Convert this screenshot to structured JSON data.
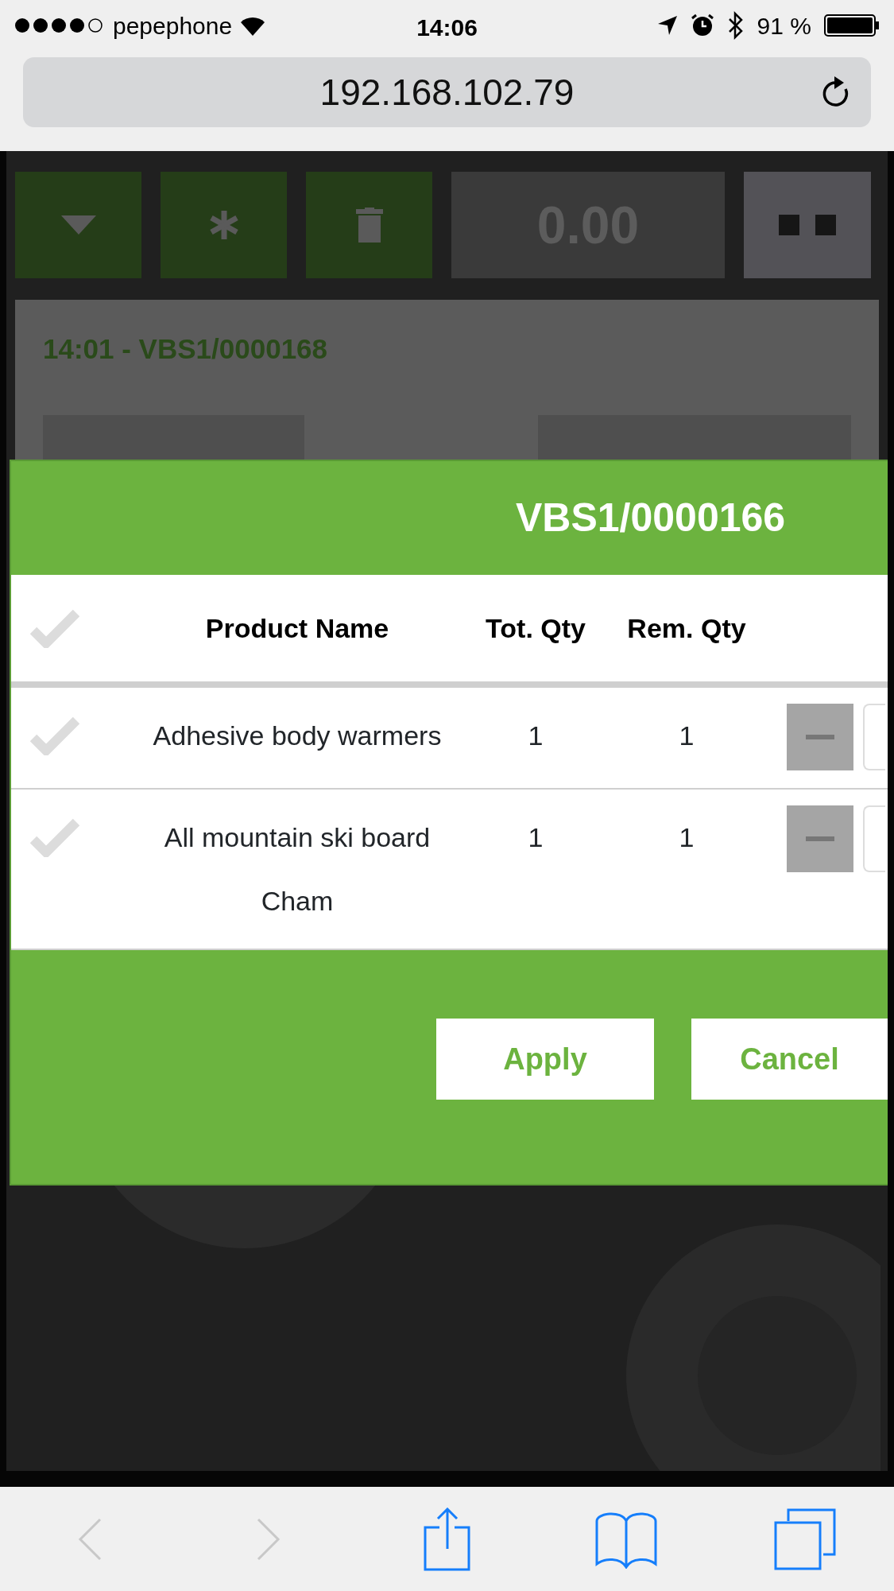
{
  "status_bar": {
    "carrier": "pepephone",
    "time": "14:06",
    "battery": "91 %"
  },
  "browser": {
    "url": "192.168.102.79"
  },
  "toolbar": {
    "total": "0.00"
  },
  "order_card": {
    "title": "14:01 - VBS1/0000168"
  },
  "modal": {
    "title": "VBS1/0000166",
    "header_checked": false,
    "columns": [
      "Product Name",
      "Tot. Qty",
      "Rem. Qty"
    ],
    "rows": [
      {
        "product": "Adhesive body warmers",
        "total_qty": "1",
        "remaining_qty": "1",
        "checked": false
      },
      {
        "product": "All mountain ski board Cham",
        "total_qty": "1",
        "remaining_qty": "1",
        "checked": false
      }
    ],
    "buttons": [
      "Apply",
      "Cancel"
    ]
  },
  "browser_toolbar": {
    "back_disabled": true,
    "forward_disabled": true
  }
}
